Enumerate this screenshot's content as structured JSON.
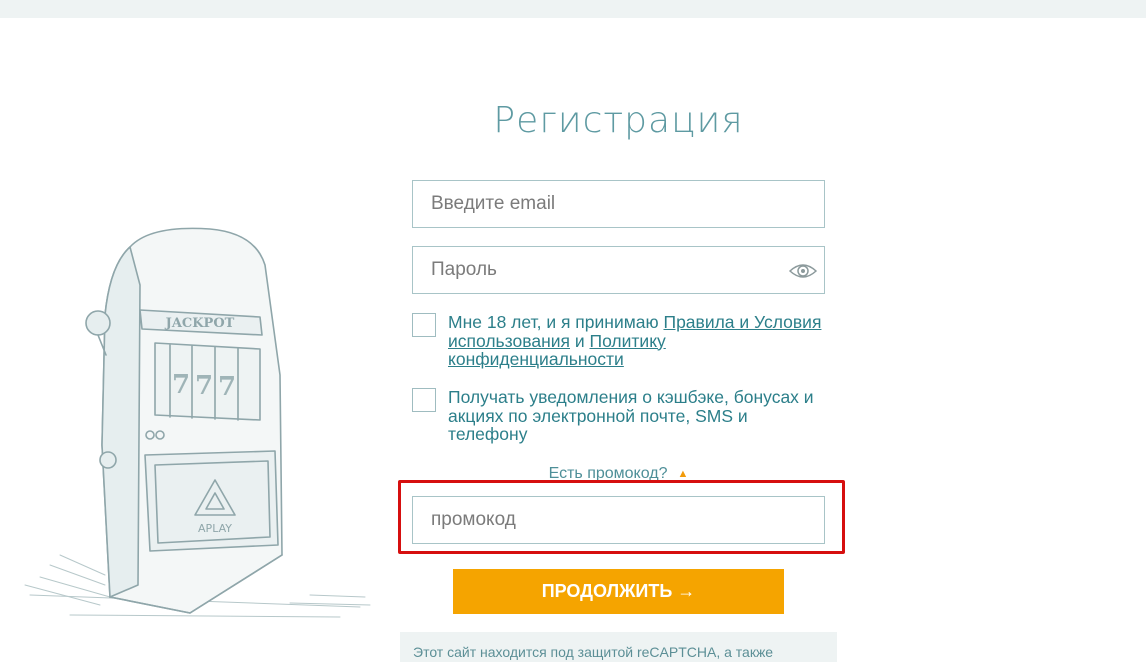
{
  "page": {
    "title": "Регистрация"
  },
  "form": {
    "email_placeholder": "Введите email",
    "password_placeholder": "Пароль",
    "terms": {
      "prefix": "Мне 18 лет, и я принимаю ",
      "terms_link": "Правила и Условия использования",
      "middle": " и ",
      "privacy_link": "Политику конфиденциальности"
    },
    "notifications_text": "Получать уведомления о кэшбэке, бонусах и акциях по электронной почте, SMS и телефону",
    "promo_toggle": "Есть промокод?",
    "promo_placeholder": "промокод",
    "continue_label": "ПРОДОЛЖИТЬ →",
    "captcha_note": "Этот сайт находится под защитой reCAPTCHA, а также"
  },
  "illustration": {
    "jackpot_text": "JACKPOT",
    "reels": [
      "7",
      "7",
      "7"
    ],
    "brand": "APLAY"
  },
  "colors": {
    "accent": "#f5a400",
    "title": "#5e9aa2",
    "link": "#2c7f8a",
    "highlight": "#d60f0f"
  }
}
